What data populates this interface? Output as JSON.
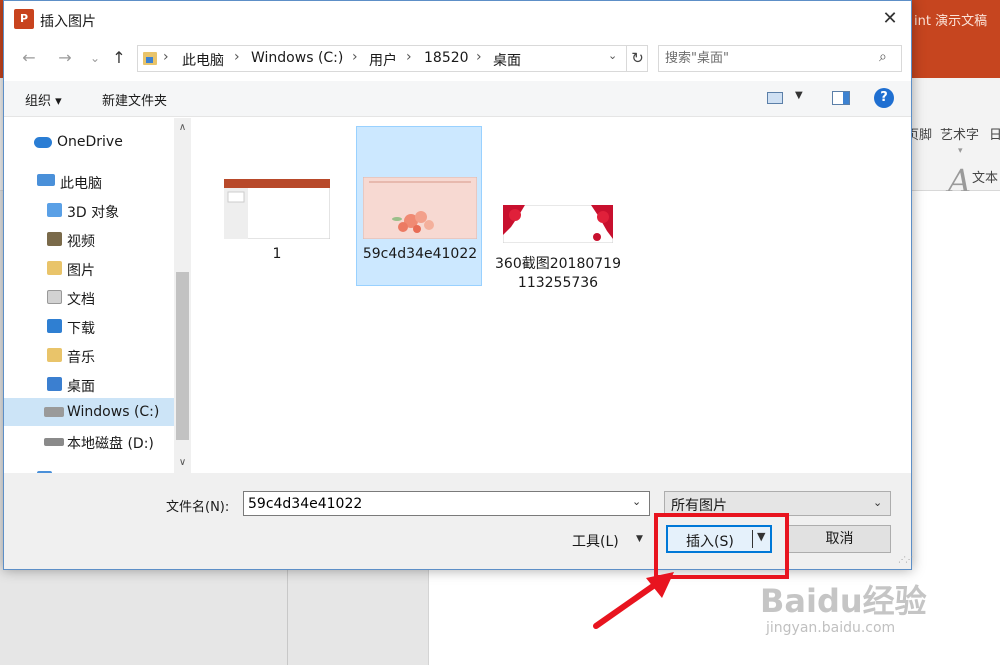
{
  "ppt": {
    "title_fragment": "int 演示文稿",
    "ribbon_items": [
      "页脚",
      "艺术字",
      "日"
    ],
    "group_label": "文本"
  },
  "dialog": {
    "app_icon": "P",
    "title": "插入图片",
    "close": "✕"
  },
  "nav": {
    "back": "←",
    "forward": "→",
    "recent": "⌄",
    "up": "↑",
    "breadcrumb": [
      "此电脑",
      "Windows (C:)",
      "用户",
      "18520",
      "桌面"
    ],
    "refresh": "↻",
    "search_placeholder": "搜索\"桌面\""
  },
  "toolbar": {
    "organize": "组织 ▾",
    "new_folder": "新建文件夹"
  },
  "sidebar": {
    "items": [
      {
        "label": "OneDrive",
        "icon": "cloud-icon",
        "color": "#2a7dd4"
      },
      {
        "label": "此电脑",
        "icon": "computer-icon",
        "color": "#4a90d9"
      },
      {
        "label": "3D 对象",
        "icon": "3d-objects-icon",
        "color": "#5aa0e6"
      },
      {
        "label": "视频",
        "icon": "video-folder-icon",
        "color": "#7a6a4a"
      },
      {
        "label": "图片",
        "icon": "pictures-folder-icon",
        "color": "#e9c46a"
      },
      {
        "label": "文档",
        "icon": "documents-folder-icon",
        "color": "#c9c9c9"
      },
      {
        "label": "下载",
        "icon": "downloads-folder-icon",
        "color": "#2f7fd2"
      },
      {
        "label": "音乐",
        "icon": "music-folder-icon",
        "color": "#e9c46a"
      },
      {
        "label": "桌面",
        "icon": "desktop-folder-icon",
        "color": "#3b7fd0"
      },
      {
        "label": "Windows (C:)",
        "icon": "windows-drive-icon",
        "color": "#9a9a9a"
      },
      {
        "label": "本地磁盘 (D:)",
        "icon": "local-drive-icon",
        "color": "#8a8a8a"
      },
      {
        "label": "网络",
        "icon": "network-icon",
        "color": "#4a90d9"
      }
    ],
    "selected_index": 9
  },
  "files": [
    {
      "name": "1",
      "thumb": "pptx-thumb"
    },
    {
      "name": "59c4d34e41022",
      "thumb": "roses-thumb"
    },
    {
      "name": "360截图20180719113255736",
      "thumb": "red-flowers-thumb"
    }
  ],
  "bottom": {
    "filename_label": "文件名(N):",
    "filename_value": "59c4d34e41022",
    "filetype": "所有图片",
    "tools": "工具(L)",
    "insert": "插入(S)",
    "cancel": "取消"
  },
  "watermark": {
    "brand": "Baidu经验",
    "url": "jingyan.baidu.com"
  }
}
